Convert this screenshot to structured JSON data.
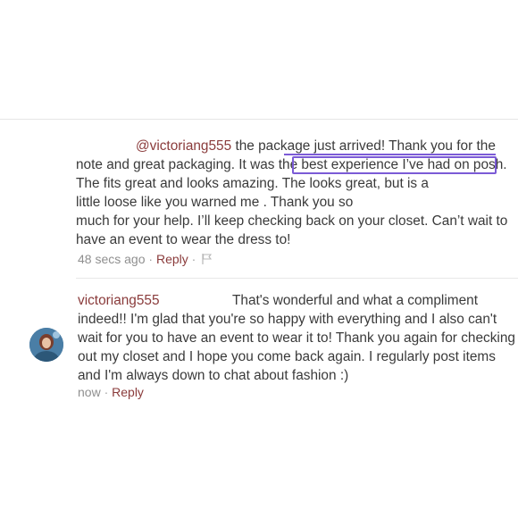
{
  "comment1": {
    "mention": "@victoriang555",
    "lines": [
      " the package just arrived! Thank you for the",
      "note and great packaging. It was the best experience I’ve had on posh.",
      "The            fits great and looks amazing. The            looks great, but is a",
      "little loose like you warned me                                   . Thank you so",
      "much for your help. I’ll keep checking back on your closet. Can’t wait to",
      "have an event to wear the dress to!"
    ],
    "time": "48 secs ago",
    "reply_label": "Reply",
    "separator": "·",
    "flag_icon": "flag-icon"
  },
  "comment2": {
    "username": "victoriang555",
    "lines": [
      "That's wonderful and what a compliment",
      "indeed!! I'm glad that you're so happy with everything and I also can't",
      "wait for you to have an event to wear it to! Thank you again for checking",
      "out my closet and I hope you come back again. I regularly post items",
      "and I'm always down to chat about fashion :)"
    ],
    "time": "now",
    "reply_label": "Reply",
    "separator": "·"
  },
  "colors": {
    "username": "#8a3b3b",
    "highlight": "#7b5bd6",
    "text": "#3a3a3a"
  }
}
